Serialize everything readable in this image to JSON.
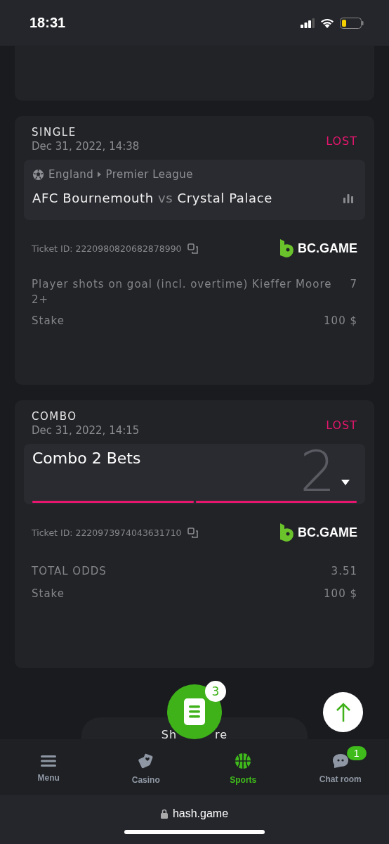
{
  "status_bar": {
    "time": "18:31"
  },
  "bets": [
    {
      "kind": "single",
      "type_label": "SINGLE",
      "date": "Dec 31, 2022, 14:38",
      "result": "LOST",
      "event": {
        "country": "England",
        "league": "Premier League",
        "home": "AFC Bournemouth",
        "vs": "vs",
        "away": "Crystal Palace"
      },
      "ticket": "Ticket ID: 2220980820682878990",
      "brand": "BC.GAME",
      "selection": "Player shots on goal (incl. overtime) Kieffer Moore 2+",
      "odds": "7",
      "stake_label": "Stake",
      "stake": "100 $"
    },
    {
      "kind": "combo",
      "type_label": "COMBO",
      "date": "Dec 31, 2022, 14:15",
      "result": "LOST",
      "combo_title": "Combo 2 Bets",
      "combo_count": "2",
      "expanded": false,
      "legs": [
        {
          "color": "#e6166e"
        },
        {
          "color": "#e6166e"
        }
      ],
      "ticket": "Ticket ID: 2220973974043631710",
      "brand": "BC.GAME",
      "odds_label": "TOTAL ODDS",
      "odds": "3.51",
      "stake_label": "Stake",
      "stake": "100 $"
    }
  ],
  "show_more": {
    "visible_parts": [
      "Sh",
      "re"
    ]
  },
  "betslip": {
    "count": "3"
  },
  "nav": [
    {
      "kind": "menu",
      "label": "Menu",
      "selected": false
    },
    {
      "kind": "casino",
      "label": "Casino",
      "selected": false
    },
    {
      "kind": "sports",
      "label": "Sports",
      "selected": true
    },
    {
      "kind": "chat",
      "label": "Chat room",
      "selected": false,
      "badge": "1"
    }
  ],
  "browser": {
    "url": "hash.game"
  }
}
